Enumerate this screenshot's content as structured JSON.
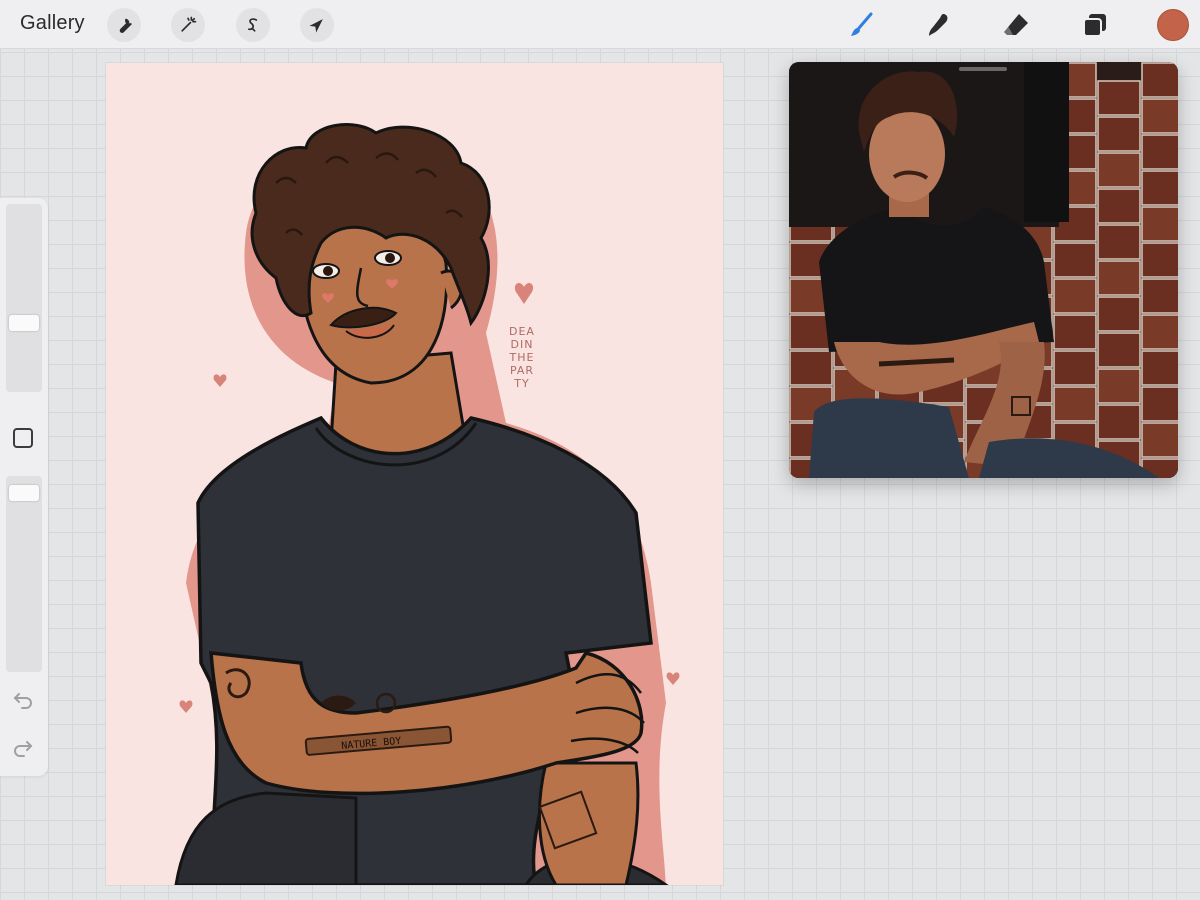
{
  "topbar": {
    "gallery_label": "Gallery",
    "left_tools": [
      "wrench-icon",
      "magic-wand-icon",
      "selection-icon",
      "arrow-icon"
    ],
    "right_tools": [
      "brush-icon",
      "smudge-icon",
      "eraser-icon",
      "layers-icon"
    ],
    "active_tool": "brush-icon",
    "accent_color": "#2f7fe0",
    "current_color": "#c2634a"
  },
  "sidebar": {
    "brush_size_level": 0.33,
    "opacity_level": 0.95
  },
  "canvas": {
    "signature_lines": [
      "DEA",
      "DIN",
      "THE",
      "PAR",
      "TY"
    ],
    "tattoo_text": "NATURE BOY",
    "background_color": "#f9e4e1",
    "shirt_color": "#2f3139",
    "skin_color": "#b8734a",
    "hair_color": "#4a2a1c",
    "outline_color": "#e3978c"
  },
  "reference": {
    "tile_color": "#6b2f22",
    "shirt_color": "#151517",
    "jeans_color": "#2e3a4a"
  }
}
